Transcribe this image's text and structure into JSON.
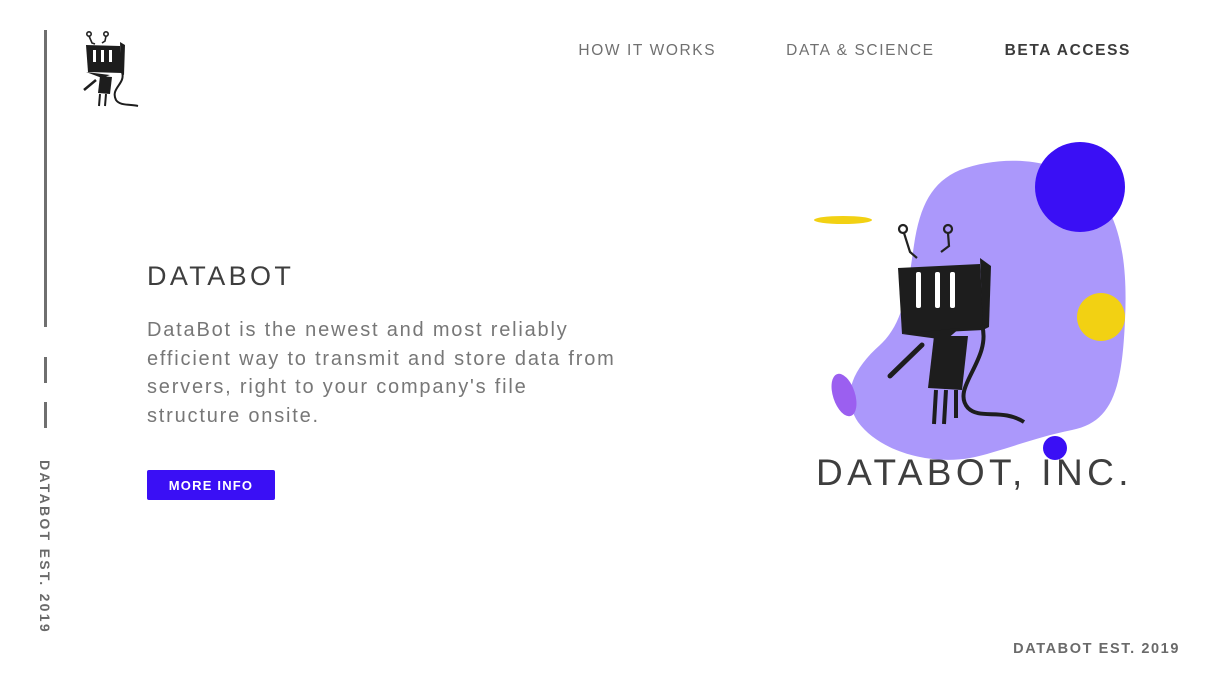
{
  "sidebar": {
    "vertical_text": "DATABOT EST. 2019"
  },
  "nav": {
    "items": [
      {
        "label": "HOW IT WORKS"
      },
      {
        "label": "DATA & SCIENCE"
      },
      {
        "label": "BETA ACCESS"
      }
    ]
  },
  "hero": {
    "title": "DATABOT",
    "description": "DataBot is the newest and most reliably efficient way to transmit and store data from servers, right to your company's file structure onsite.",
    "button_label": "MORE INFO"
  },
  "illustration": {
    "company_name": "DATABOT, INC.",
    "colors": {
      "blob": "#ab98fb",
      "accent_blue": "#3a0ff5",
      "accent_yellow": "#f2d113",
      "accent_purple": "#9b5ff0"
    }
  },
  "footer": {
    "text": "DATABOT EST. 2019"
  },
  "theme": {
    "button_color": "#3a0ff5",
    "text_dark": "#3e3e3e",
    "text_gray": "#777777"
  }
}
